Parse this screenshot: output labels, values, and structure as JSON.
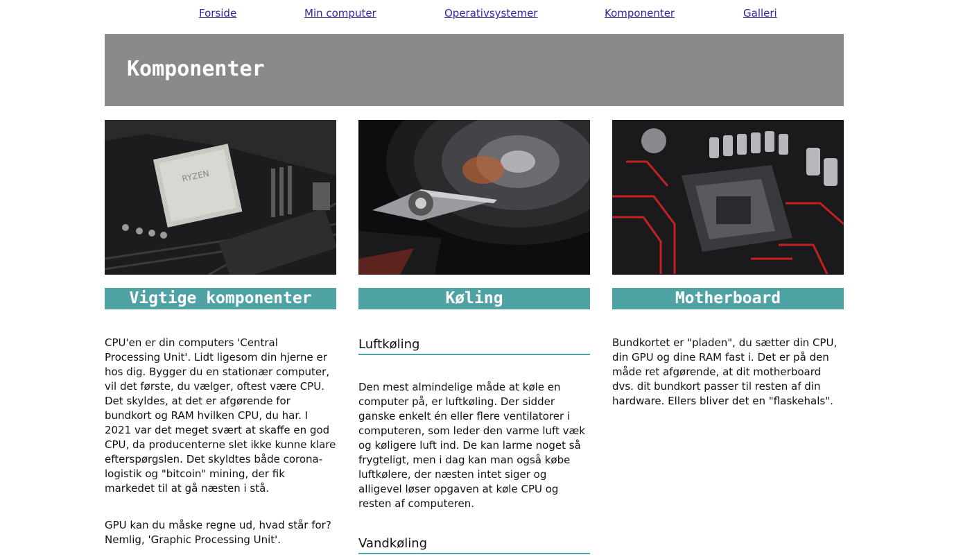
{
  "nav": {
    "items": [
      "Forside",
      "Min computer",
      "Operativsystemer",
      "Komponenter",
      "Galleri"
    ]
  },
  "banner": {
    "title": "Komponenter"
  },
  "columns": [
    {
      "image_icon": "cpu-motherboard-photo",
      "title": "Vigtige komponenter",
      "paragraphs": [
        "CPU'en er din computers 'Central Processing Unit'. Lidt ligesom din hjerne er hos dig. Bygger du en stationær computer, vil det første, du vælger, oftest være CPU. Det skyldes, at det er afgørende for bundkort og RAM hvilken CPU, du har. I 2021 var det meget svært at skaffe en god CPU, da producenterne slet ikke kunne klare efterspørgslen. Det skyldtes både corona-logistik og \"bitcoin\" mining, der fik markedet til at gå næsten i stå.",
        "GPU kan du måske regne ud, hvad står for? Nemlig, 'Graphic Processing Unit'."
      ]
    },
    {
      "image_icon": "hard-drive-photo",
      "title": "Køling",
      "subheadings": [
        "Luftkøling",
        "Vandkøling"
      ],
      "paragraphs": [
        "Den mest almindelige måde at køle en computer på, er luftkøling. Der sidder ganske enkelt én eller flere ventilatorer i computeren, som leder den varme luft væk og køligere luft ind. De kan larme noget så frygteligt, men i dag kan man også købe luftkølere, der næsten intet siger og alligevel løser opgaven at køle CPU og resten af computeren."
      ]
    },
    {
      "image_icon": "motherboard-socket-photo",
      "title": "Motherboard",
      "paragraphs": [
        "Bundkortet er \"pladen\", du sætter din CPU, din GPU og dine RAM fast i. Det er på den måde ret afgørende, at dit motherboard dvs. dit bundkort passer til resten af din hardware. Ellers bliver det en \"flaskehals\"."
      ]
    }
  ],
  "colors": {
    "accent": "#4fa3a5",
    "banner": "#8a8a8a",
    "link": "#3a23a6"
  }
}
